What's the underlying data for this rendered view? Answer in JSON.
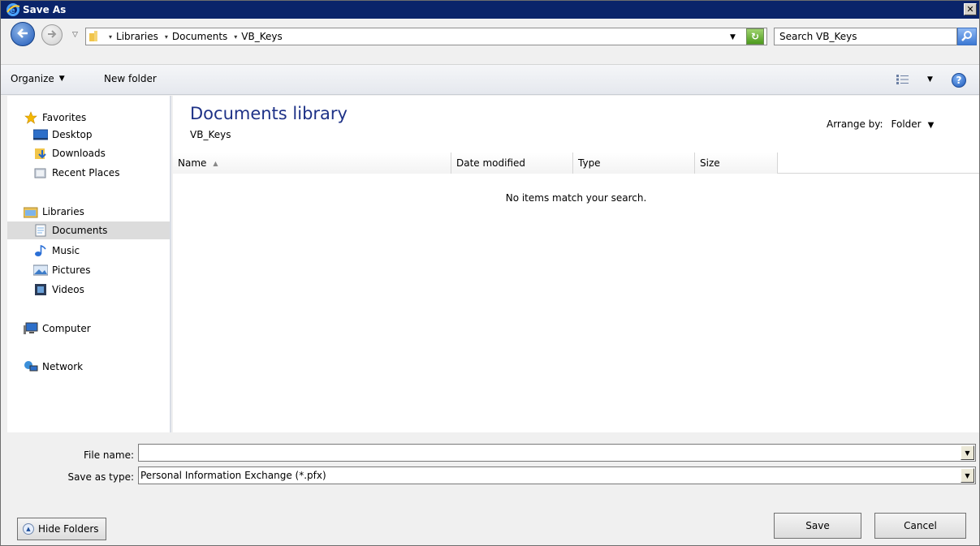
{
  "window": {
    "title": "Save As"
  },
  "address": {
    "crumbs": [
      "Libraries",
      "Documents",
      "VB_Keys"
    ],
    "search_placeholder": "Search VB_Keys"
  },
  "toolbar": {
    "organize": "Organize",
    "new_folder": "New folder"
  },
  "nav": {
    "favorites": "Favorites",
    "desktop": "Desktop",
    "downloads": "Downloads",
    "recent_places": "Recent Places",
    "libraries": "Libraries",
    "documents": "Documents",
    "music": "Music",
    "pictures": "Pictures",
    "videos": "Videos",
    "computer": "Computer",
    "network": "Network"
  },
  "content": {
    "title": "Documents library",
    "subtitle": "VB_Keys",
    "arrange_label": "Arrange by:",
    "arrange_value": "Folder",
    "columns": [
      "Name",
      "Date modified",
      "Type",
      "Size"
    ],
    "empty_message": "No items match your search."
  },
  "form": {
    "filename_label": "File name:",
    "filename_value": "",
    "savetype_label": "Save as type:",
    "savetype_value": "Personal Information Exchange (*.pfx)"
  },
  "buttons": {
    "hide_folders": "Hide Folders",
    "save": "Save",
    "cancel": "Cancel"
  }
}
